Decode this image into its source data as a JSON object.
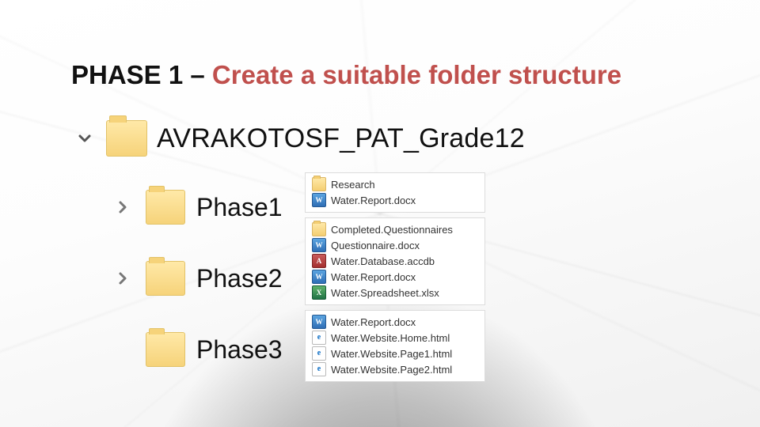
{
  "heading": {
    "pre": "PHASE 1 – ",
    "main": "Create a suitable folder structure"
  },
  "root": {
    "name": "AVRAKOTOSF_PAT_Grade12"
  },
  "subs": [
    {
      "name": "Phase1",
      "expandable": true
    },
    {
      "name": "Phase2",
      "expandable": true
    },
    {
      "name": "Phase3",
      "expandable": false
    }
  ],
  "panels": [
    {
      "items": [
        {
          "icon": "folder",
          "label": "Research"
        },
        {
          "icon": "word",
          "label": "Water.Report.docx"
        }
      ]
    },
    {
      "items": [
        {
          "icon": "folder",
          "label": "Completed.Questionnaires"
        },
        {
          "icon": "word",
          "label": "Questionnaire.docx"
        },
        {
          "icon": "access",
          "label": "Water.Database.accdb"
        },
        {
          "icon": "word",
          "label": "Water.Report.docx"
        },
        {
          "icon": "excel",
          "label": "Water.Spreadsheet.xlsx"
        }
      ]
    },
    {
      "items": [
        {
          "icon": "word",
          "label": "Water.Report.docx"
        },
        {
          "icon": "html",
          "label": "Water.Website.Home.html"
        },
        {
          "icon": "html",
          "label": "Water.Website.Page1.html"
        },
        {
          "icon": "html",
          "label": "Water.Website.Page2.html"
        }
      ]
    }
  ]
}
